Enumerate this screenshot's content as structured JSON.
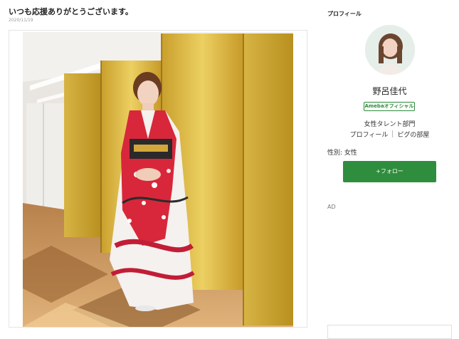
{
  "post": {
    "title": "いつも応援ありがとうございます。",
    "date": "2020/11/19"
  },
  "sidebar": {
    "heading": "プロフィール",
    "name": "野呂佳代",
    "badge": "Amebaオフィシャル",
    "category": "女性タレント部門",
    "links": [
      "プロフィール",
      "ピグの部屋"
    ],
    "gender": "性別: 女性",
    "follow_label": "+フォロー",
    "ad_label": "AD"
  },
  "colors": {
    "follow_green": "#2f8e3e",
    "badge_green": "#2d8b3a",
    "screen_gold": "#d9b33a",
    "kimono_red": "#d8273a"
  },
  "icons": {
    "follow": "plus-icon"
  }
}
